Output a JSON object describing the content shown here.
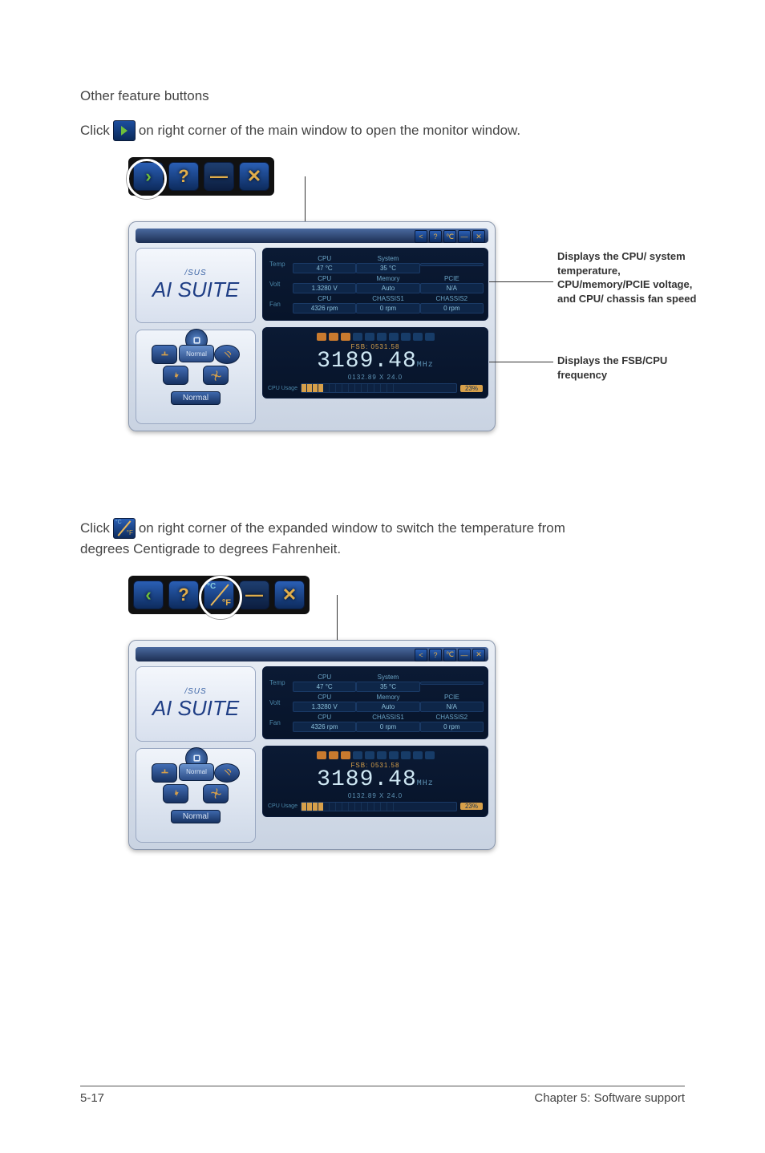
{
  "page": {
    "number": "5-17",
    "chapter": "Chapter 5: Software support"
  },
  "section_title": "Other feature buttons",
  "paragraph1": {
    "prefix": "Click",
    "suffix": "on right corner of the main window to open the monitor window."
  },
  "paragraph2": {
    "prefix": "Click",
    "suffix_line1": "on right corner of the expanded window to switch the temperature from",
    "suffix_line2": "degrees Centigrade to degrees Fahrenheit."
  },
  "callouts": {
    "top": "Displays the CPU/ system temperature, CPU/memory/PCIE voltage, and CPU/ chassis fan speed",
    "bottom": "Displays the FSB/CPU frequency"
  },
  "suite": {
    "brand": "/SUS",
    "product": "AI SUITE",
    "mode": "Normal",
    "center_btn": "Normal"
  },
  "stats": {
    "rows": [
      {
        "label": "Temp",
        "cells": [
          {
            "h": "CPU",
            "v": "47 °C"
          },
          {
            "h": "System",
            "v": "35 °C"
          },
          {
            "h": "",
            "v": ""
          }
        ]
      },
      {
        "label": "Volt",
        "cells": [
          {
            "h": "CPU",
            "v": "1.3280 V"
          },
          {
            "h": "Memory",
            "v": "Auto"
          },
          {
            "h": "PCIE",
            "v": "N/A"
          }
        ]
      },
      {
        "label": "Fan",
        "cells": [
          {
            "h": "CPU",
            "v": "4326 rpm"
          },
          {
            "h": "CHASSIS1",
            "v": "0 rpm"
          },
          {
            "h": "CHASSIS2",
            "v": "0 rpm"
          }
        ]
      }
    ]
  },
  "freq": {
    "fsb": "FSB: 0531.58",
    "main": "3189.48",
    "unit": "MHz",
    "mult": "0132.89 X 24.0",
    "usage_label": "CPU Usage",
    "usage_pct": "23%"
  },
  "toolbar": {
    "back": "<",
    "expand": ">",
    "help": "?",
    "cf_c": "°C",
    "cf_f": "°F",
    "min": "—",
    "close": "✕"
  }
}
